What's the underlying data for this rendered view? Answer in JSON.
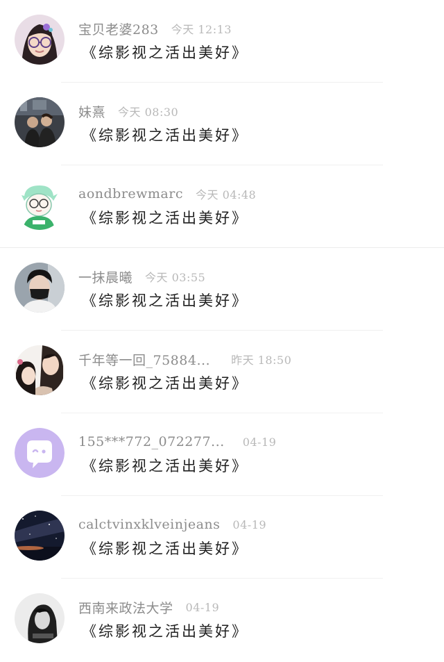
{
  "comments": [
    {
      "name": "宝贝老婆283",
      "time": "今天 12:13",
      "text": "《综影视之活出美好》",
      "avatar": "avatar-girl-glasses-icon"
    },
    {
      "name": "妹熹",
      "time": "今天 08:30",
      "text": "《综影视之活出美好》",
      "avatar": "avatar-couple-photo-icon"
    },
    {
      "name": "aondbrewmarc",
      "time": "今天 04:48",
      "text": "《综影视之活出美好》",
      "avatar": "avatar-cartoon-boy-icon"
    },
    {
      "name": "一抹晨曦",
      "time": "今天 03:55",
      "text": "《综影视之活出美好》",
      "avatar": "avatar-man-mask-icon"
    },
    {
      "name": "千年等一回_75884...",
      "time": "昨天 18:50",
      "text": "《综影视之活出美好》",
      "avatar": "avatar-couple-drama-icon"
    },
    {
      "name": "155***772_072277...",
      "time": "04-19",
      "text": "《综影视之活出美好》",
      "avatar": "avatar-default-chat-icon"
    },
    {
      "name": "calctvinxklveinjeans",
      "time": "04-19",
      "text": "《综影视之活出美好》",
      "avatar": "avatar-night-sky-icon"
    },
    {
      "name": "西南来政法大学",
      "time": "04-19",
      "text": "《综影视之活出美好》",
      "avatar": "avatar-bw-portrait-icon"
    }
  ],
  "colors": {
    "name": "#8c8c8c",
    "time": "#b8b8b8",
    "comment": "#1f1f1f",
    "default_avatar": "#c9b6f0"
  }
}
